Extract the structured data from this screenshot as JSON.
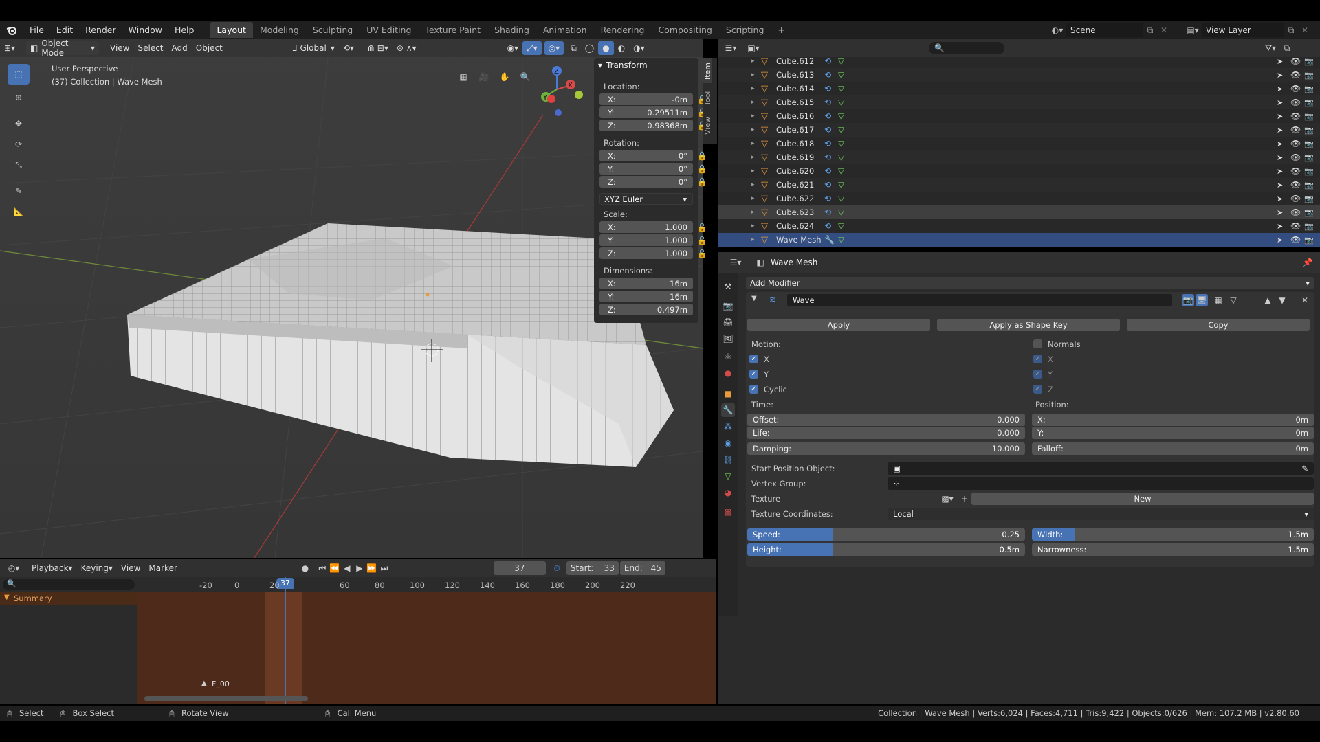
{
  "menu": [
    "File",
    "Edit",
    "Render",
    "Window",
    "Help"
  ],
  "workspaces": [
    "Layout",
    "Modeling",
    "Sculpting",
    "UV Editing",
    "Texture Paint",
    "Shading",
    "Animation",
    "Rendering",
    "Compositing",
    "Scripting"
  ],
  "active_workspace": "Layout",
  "scene": "Scene",
  "view_layer": "View Layer",
  "viewport": {
    "mode": "Object Mode",
    "menus": [
      "View",
      "Select",
      "Add",
      "Object"
    ],
    "orientation": "Global",
    "title": "User Perspective",
    "subtitle": "(37) Collection | Wave Mesh"
  },
  "npanel": {
    "tabs": [
      "Item",
      "Tool",
      "View"
    ],
    "header": "Transform",
    "location_label": "Location:",
    "location": {
      "x": "-0m",
      "y": "0.29511m",
      "z": "0.98368m"
    },
    "rotation_label": "Rotation:",
    "rotation": {
      "x": "0°",
      "y": "0°",
      "z": "0°"
    },
    "rotation_mode": "XYZ Euler",
    "scale_label": "Scale:",
    "scale": {
      "x": "1.000",
      "y": "1.000",
      "z": "1.000"
    },
    "dimensions_label": "Dimensions:",
    "dimensions": {
      "x": "16m",
      "y": "16m",
      "z": "0.497m"
    },
    "axis": {
      "x": "X:",
      "y": "Y:",
      "z": "Z:"
    }
  },
  "outliner": {
    "rows": [
      "Cube.612",
      "Cube.613",
      "Cube.614",
      "Cube.615",
      "Cube.616",
      "Cube.617",
      "Cube.618",
      "Cube.619",
      "Cube.620",
      "Cube.621",
      "Cube.622",
      "Cube.623",
      "Cube.624",
      "Wave Mesh"
    ]
  },
  "properties": {
    "object_name": "Wave Mesh",
    "add_modifier": "Add Modifier",
    "modifier_name": "Wave",
    "apply": "Apply",
    "apply_shape_key": "Apply as Shape Key",
    "copy": "Copy",
    "motion_label": "Motion:",
    "motion_x": "X",
    "motion_y": "Y",
    "cyclic": "Cyclic",
    "normals": "Normals",
    "normals_x": "X",
    "normals_y": "Y",
    "normals_z": "Z",
    "time_label": "Time:",
    "offset_label": "Offset:",
    "offset": "0.000",
    "life_label": "Life:",
    "life": "0.000",
    "damping_label": "Damping:",
    "damping": "10.000",
    "position_label": "Position:",
    "pos_x_label": "X:",
    "pos_x": "0m",
    "pos_y_label": "Y:",
    "pos_y": "0m",
    "falloff_label": "Falloff:",
    "falloff": "0m",
    "start_pos_label": "Start Position Object:",
    "vertex_group_label": "Vertex Group:",
    "texture_label": "Texture",
    "texture_new": "New",
    "tex_coords_label": "Texture Coordinates:",
    "tex_coords": "Local",
    "speed_label": "Speed:",
    "speed": "0.25",
    "speed_fill": 0.31,
    "width_label": "Width:",
    "width": "1.5m",
    "width_fill": 0.15,
    "height_label": "Height:",
    "height": "0.5m",
    "height_fill": 0.31,
    "narrowness_label": "Narrowness:",
    "narrowness": "1.5m"
  },
  "timeline": {
    "menus": [
      "Playback",
      "Keying",
      "View",
      "Marker"
    ],
    "current_frame": "37",
    "start_label": "Start:",
    "start": "33",
    "end_label": "End:",
    "end": "45",
    "ticks": [
      "-20",
      "0",
      "20",
      "37",
      "60",
      "80",
      "100",
      "120",
      "140",
      "160",
      "180",
      "200",
      "220"
    ],
    "summary": "Summary",
    "marker": "F_00"
  },
  "statusbar": {
    "select": "Select",
    "box_select": "Box Select",
    "rotate_view": "Rotate View",
    "call_menu": "Call Menu",
    "stats": "Collection | Wave Mesh | Verts:6,024 | Faces:4,711 | Tris:9,422 | Objects:0/626 | Mem: 107.2 MB | v2.80.60"
  },
  "colors": {
    "accent": "#4772b3",
    "selected_row": "#334d80",
    "timeline_bg": "#6b3a24",
    "object_icon": "#e89a3c",
    "mesh_icon": "#6fcf5a"
  }
}
